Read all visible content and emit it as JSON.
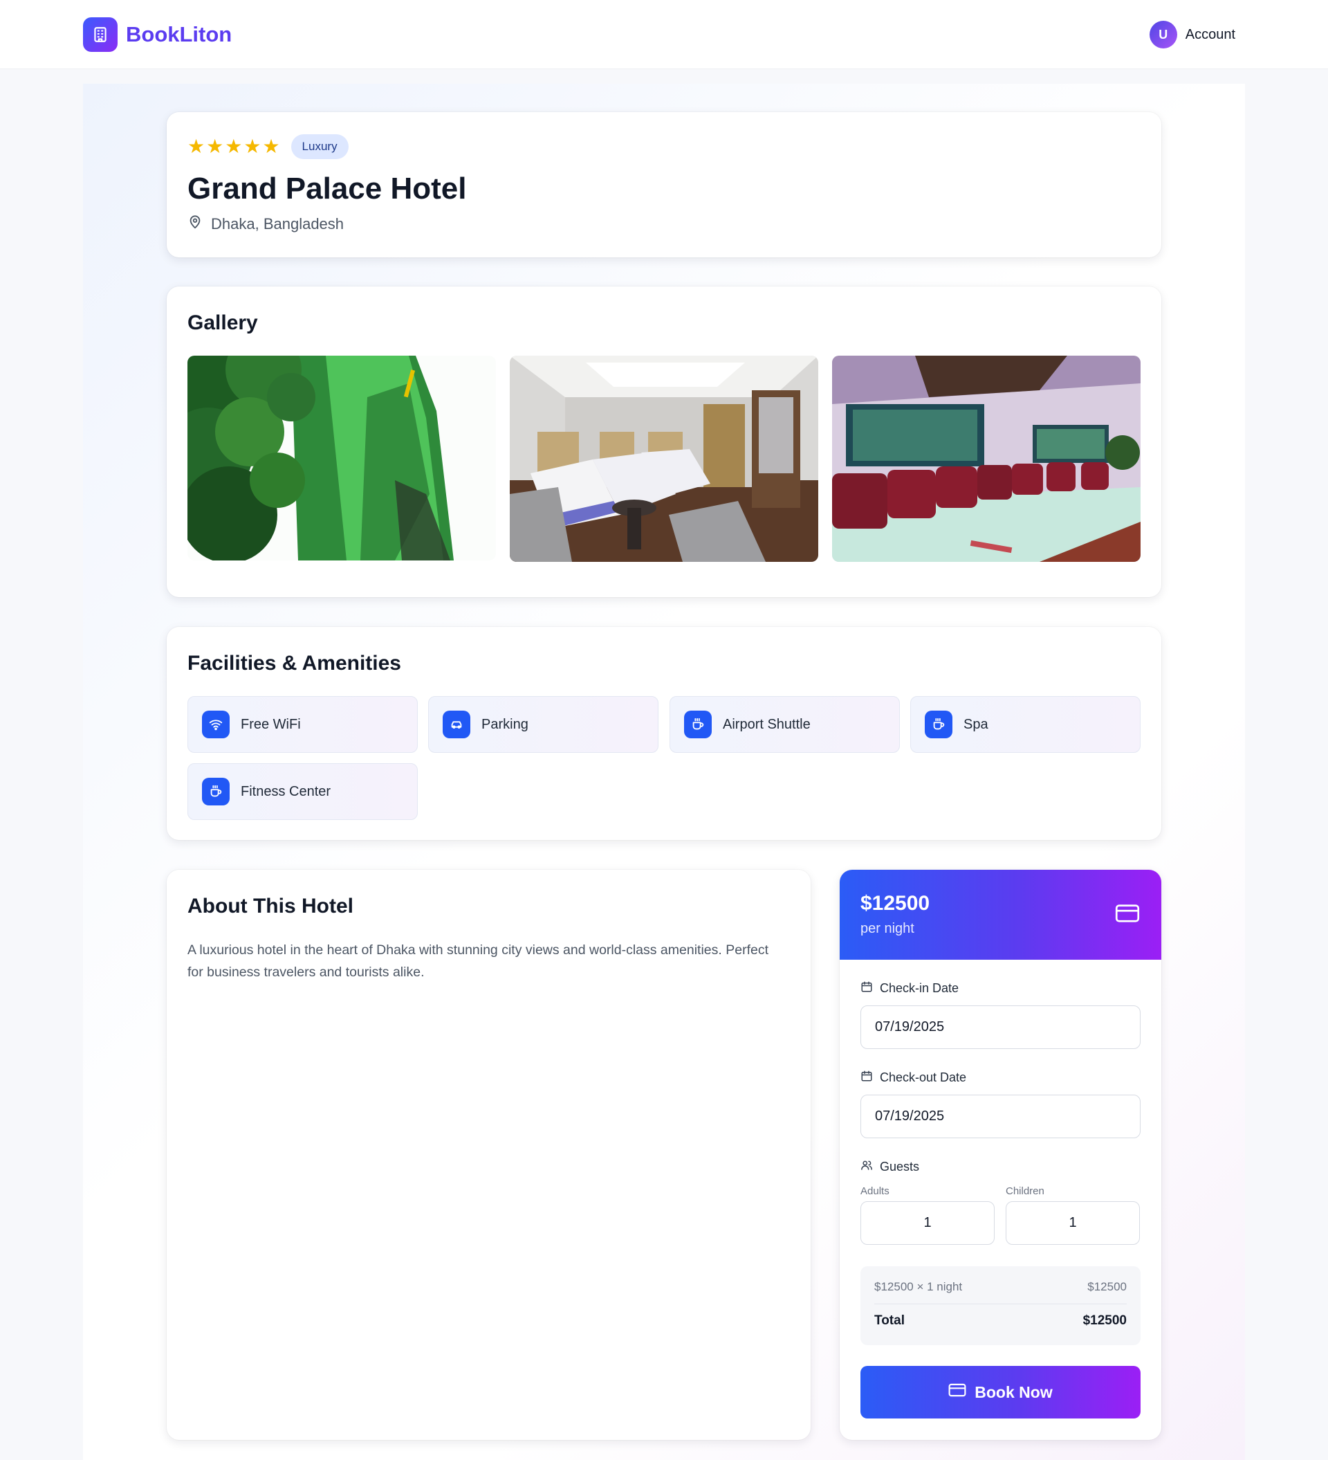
{
  "header": {
    "brand": "BookLiton",
    "account_initial": "U",
    "account_label": "Account"
  },
  "hotel": {
    "rating": 5,
    "category": "Luxury",
    "name": "Grand Palace Hotel",
    "location": "Dhaka, Bangladesh"
  },
  "gallery": {
    "title": "Gallery",
    "photos": [
      "building-exterior",
      "twin-bed-room",
      "lobby-lounge"
    ]
  },
  "facilities": {
    "title": "Facilities & Amenities",
    "items": [
      {
        "label": "Free WiFi",
        "icon": "wifi-icon"
      },
      {
        "label": "Parking",
        "icon": "car-icon"
      },
      {
        "label": "Airport Shuttle",
        "icon": "coffee-icon"
      },
      {
        "label": "Spa",
        "icon": "coffee-icon"
      },
      {
        "label": "Fitness Center",
        "icon": "coffee-icon"
      }
    ]
  },
  "about": {
    "title": "About This Hotel",
    "description": "A luxurious hotel in the heart of Dhaka with stunning city views and world-class amenities. Perfect for business travelers and tourists alike."
  },
  "booking": {
    "price": "$12500",
    "price_unit": "per night",
    "checkin_label": "Check-in Date",
    "checkin_value": "07/19/2025",
    "checkout_label": "Check-out Date",
    "checkout_value": "07/19/2025",
    "guests_label": "Guests",
    "adults_label": "Adults",
    "adults_value": "1",
    "children_label": "Children",
    "children_value": "1",
    "summary_line_label": "$12500 × 1 night",
    "summary_line_value": "$12500",
    "total_label": "Total",
    "total_value": "$12500",
    "book_label": "Book Now"
  },
  "colors": {
    "accent_blue": "#2158f5",
    "accent_purple": "#9b1ff5",
    "star": "#f5b800"
  }
}
